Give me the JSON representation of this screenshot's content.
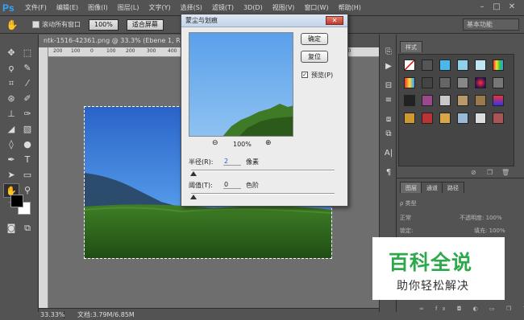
{
  "app": {
    "logo": "Ps"
  },
  "menu": [
    "文件(F)",
    "编辑(E)",
    "图像(I)",
    "图层(L)",
    "文字(Y)",
    "选择(S)",
    "滤镜(T)",
    "3D(D)",
    "视图(V)",
    "窗口(W)",
    "帮助(H)"
  ],
  "options_bar": {
    "scroll_all_label": "滚动所有窗口",
    "zoom_value": "100%",
    "fit_screen_label": "适合屏幕",
    "workspace": "基本功能"
  },
  "document": {
    "tab_title": "ntk-1516-42361.png @ 33.3% (Ebene 1, RGB/8)",
    "ruler_ticks": [
      "200",
      "100",
      "0",
      "100",
      "200",
      "300",
      "400",
      "500",
      "600",
      "700",
      "800",
      "900",
      "1000",
      "1100",
      "1200"
    ]
  },
  "status_bar": {
    "zoom": "33.33%",
    "doc_info": "文档:3.79M/6.85M"
  },
  "dialog": {
    "title": "蒙尘与划痕",
    "ok_label": "确定",
    "reset_label": "复位",
    "preview_label": "预览(P)",
    "preview_checked": true,
    "preview_zoom": "100%",
    "radius_label": "半径(R):",
    "radius_value": "2",
    "radius_unit": "像素",
    "threshold_label": "阈值(T):",
    "threshold_value": "0",
    "threshold_unit": "色阶"
  },
  "styles_panel": {
    "tab_label": "样式"
  },
  "layers_panel": {
    "tabs": [
      "图层",
      "通道",
      "路径"
    ],
    "filter_label": "类型",
    "blend_mode": "正常",
    "opacity_label": "不透明度:",
    "opacity_value": "100%",
    "lock_label": "锁定:",
    "fill_label": "填充:",
    "fill_value": "100%"
  },
  "watermark": {
    "title": "百科全说",
    "subtitle": "助你轻松解决"
  },
  "colors": {
    "ui_dark": "#535353",
    "canvas_bg": "#6e6e6e",
    "dialog_bg": "#ececec",
    "watermark_green": "#2da84a",
    "sky": "#3b7fd9",
    "forest": "#2e6b1f"
  }
}
